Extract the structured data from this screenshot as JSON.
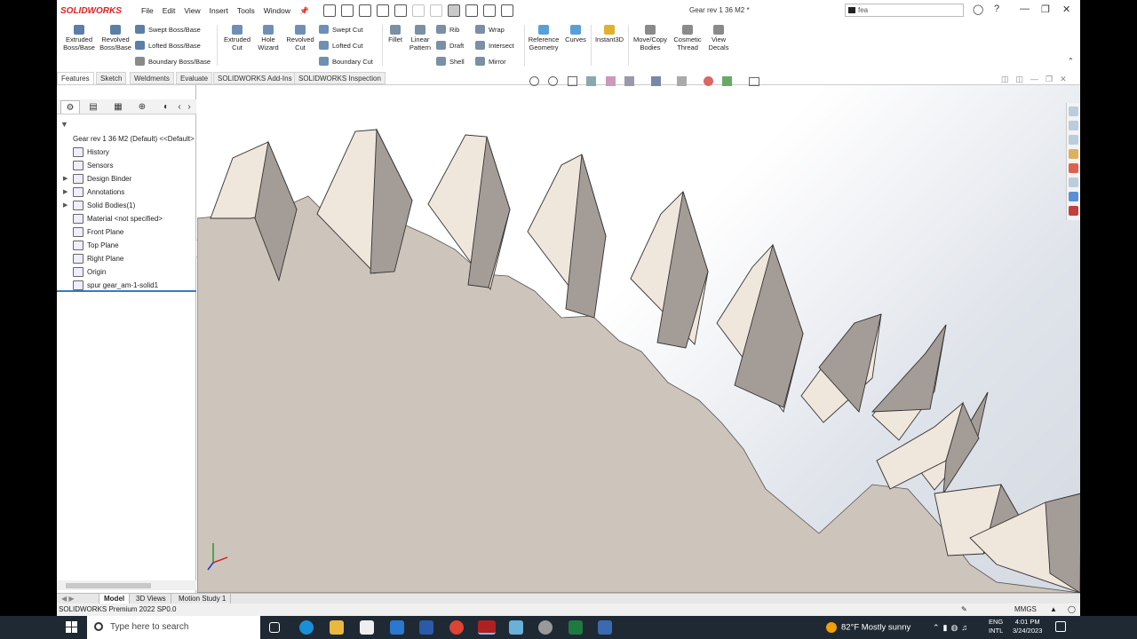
{
  "app": {
    "logo": "SOLIDWORKS",
    "menus": [
      "File",
      "Edit",
      "View",
      "Insert",
      "Tools",
      "Window"
    ],
    "document_title": "Gear rev 1 36 M2 *",
    "search_value": "fea"
  },
  "ribbon": {
    "extruded_boss": "Extruded Boss/Base",
    "revolved_boss": "Revolved Boss/Base",
    "swept_boss": "Swept Boss/Base",
    "lofted_boss": "Lofted Boss/Base",
    "boundary_boss": "Boundary Boss/Base",
    "extruded_cut": "Extruded Cut",
    "hole_wizard": "Hole Wizard",
    "revolved_cut": "Revolved Cut",
    "swept_cut": "Swept Cut",
    "lofted_cut": "Lofted Cut",
    "boundary_cut": "Boundary Cut",
    "fillet": "Fillet",
    "linear_pattern": "Linear Pattern",
    "rib": "Rib",
    "draft": "Draft",
    "shell": "Shell",
    "wrap": "Wrap",
    "intersect": "Intersect",
    "mirror": "Mirror",
    "reference_geometry": "Reference Geometry",
    "curves": "Curves",
    "instant3d": "Instant3D",
    "move_copy_bodies": "Move/Copy Bodies",
    "cosmetic_thread": "Cosmetic Thread",
    "view_decals": "View Decals"
  },
  "command_tabs": [
    "Features",
    "Sketch",
    "Weldments",
    "Evaluate",
    "SOLIDWORKS Add-Ins",
    "SOLIDWORKS Inspection"
  ],
  "tree": {
    "root": "Gear rev 1 36 M2  (Default) <<Default>",
    "items": [
      {
        "label": "History",
        "expandable": false
      },
      {
        "label": "Sensors",
        "expandable": false
      },
      {
        "label": "Design Binder",
        "expandable": true
      },
      {
        "label": "Annotations",
        "expandable": true
      },
      {
        "label": "Solid Bodies(1)",
        "expandable": true
      },
      {
        "label": "Material <not specified>",
        "expandable": false
      },
      {
        "label": "Front Plane",
        "expandable": false
      },
      {
        "label": "Top Plane",
        "expandable": false
      },
      {
        "label": "Right Plane",
        "expandable": false
      },
      {
        "label": "Origin",
        "expandable": false
      },
      {
        "label": "spur gear_am-1-solid1",
        "expandable": false
      }
    ]
  },
  "bottom_tabs": [
    "Model",
    "3D Views",
    "Motion Study 1"
  ],
  "status": {
    "version": "SOLIDWORKS Premium 2022 SP0.0",
    "units": "MMGS"
  },
  "taskbar": {
    "search_placeholder": "Type here to search",
    "weather": "82°F  Mostly sunny",
    "lang_line1": "ENG",
    "lang_line2": "INTL",
    "time": "4:01 PM",
    "date": "3/24/2023"
  },
  "colors": {
    "gear_face": "#cdc4bb",
    "tooth_light": "#efe6dc",
    "tooth_dark": "#a49c96",
    "accent_blue": "#3a78c6",
    "logo_red": "#d22222"
  }
}
